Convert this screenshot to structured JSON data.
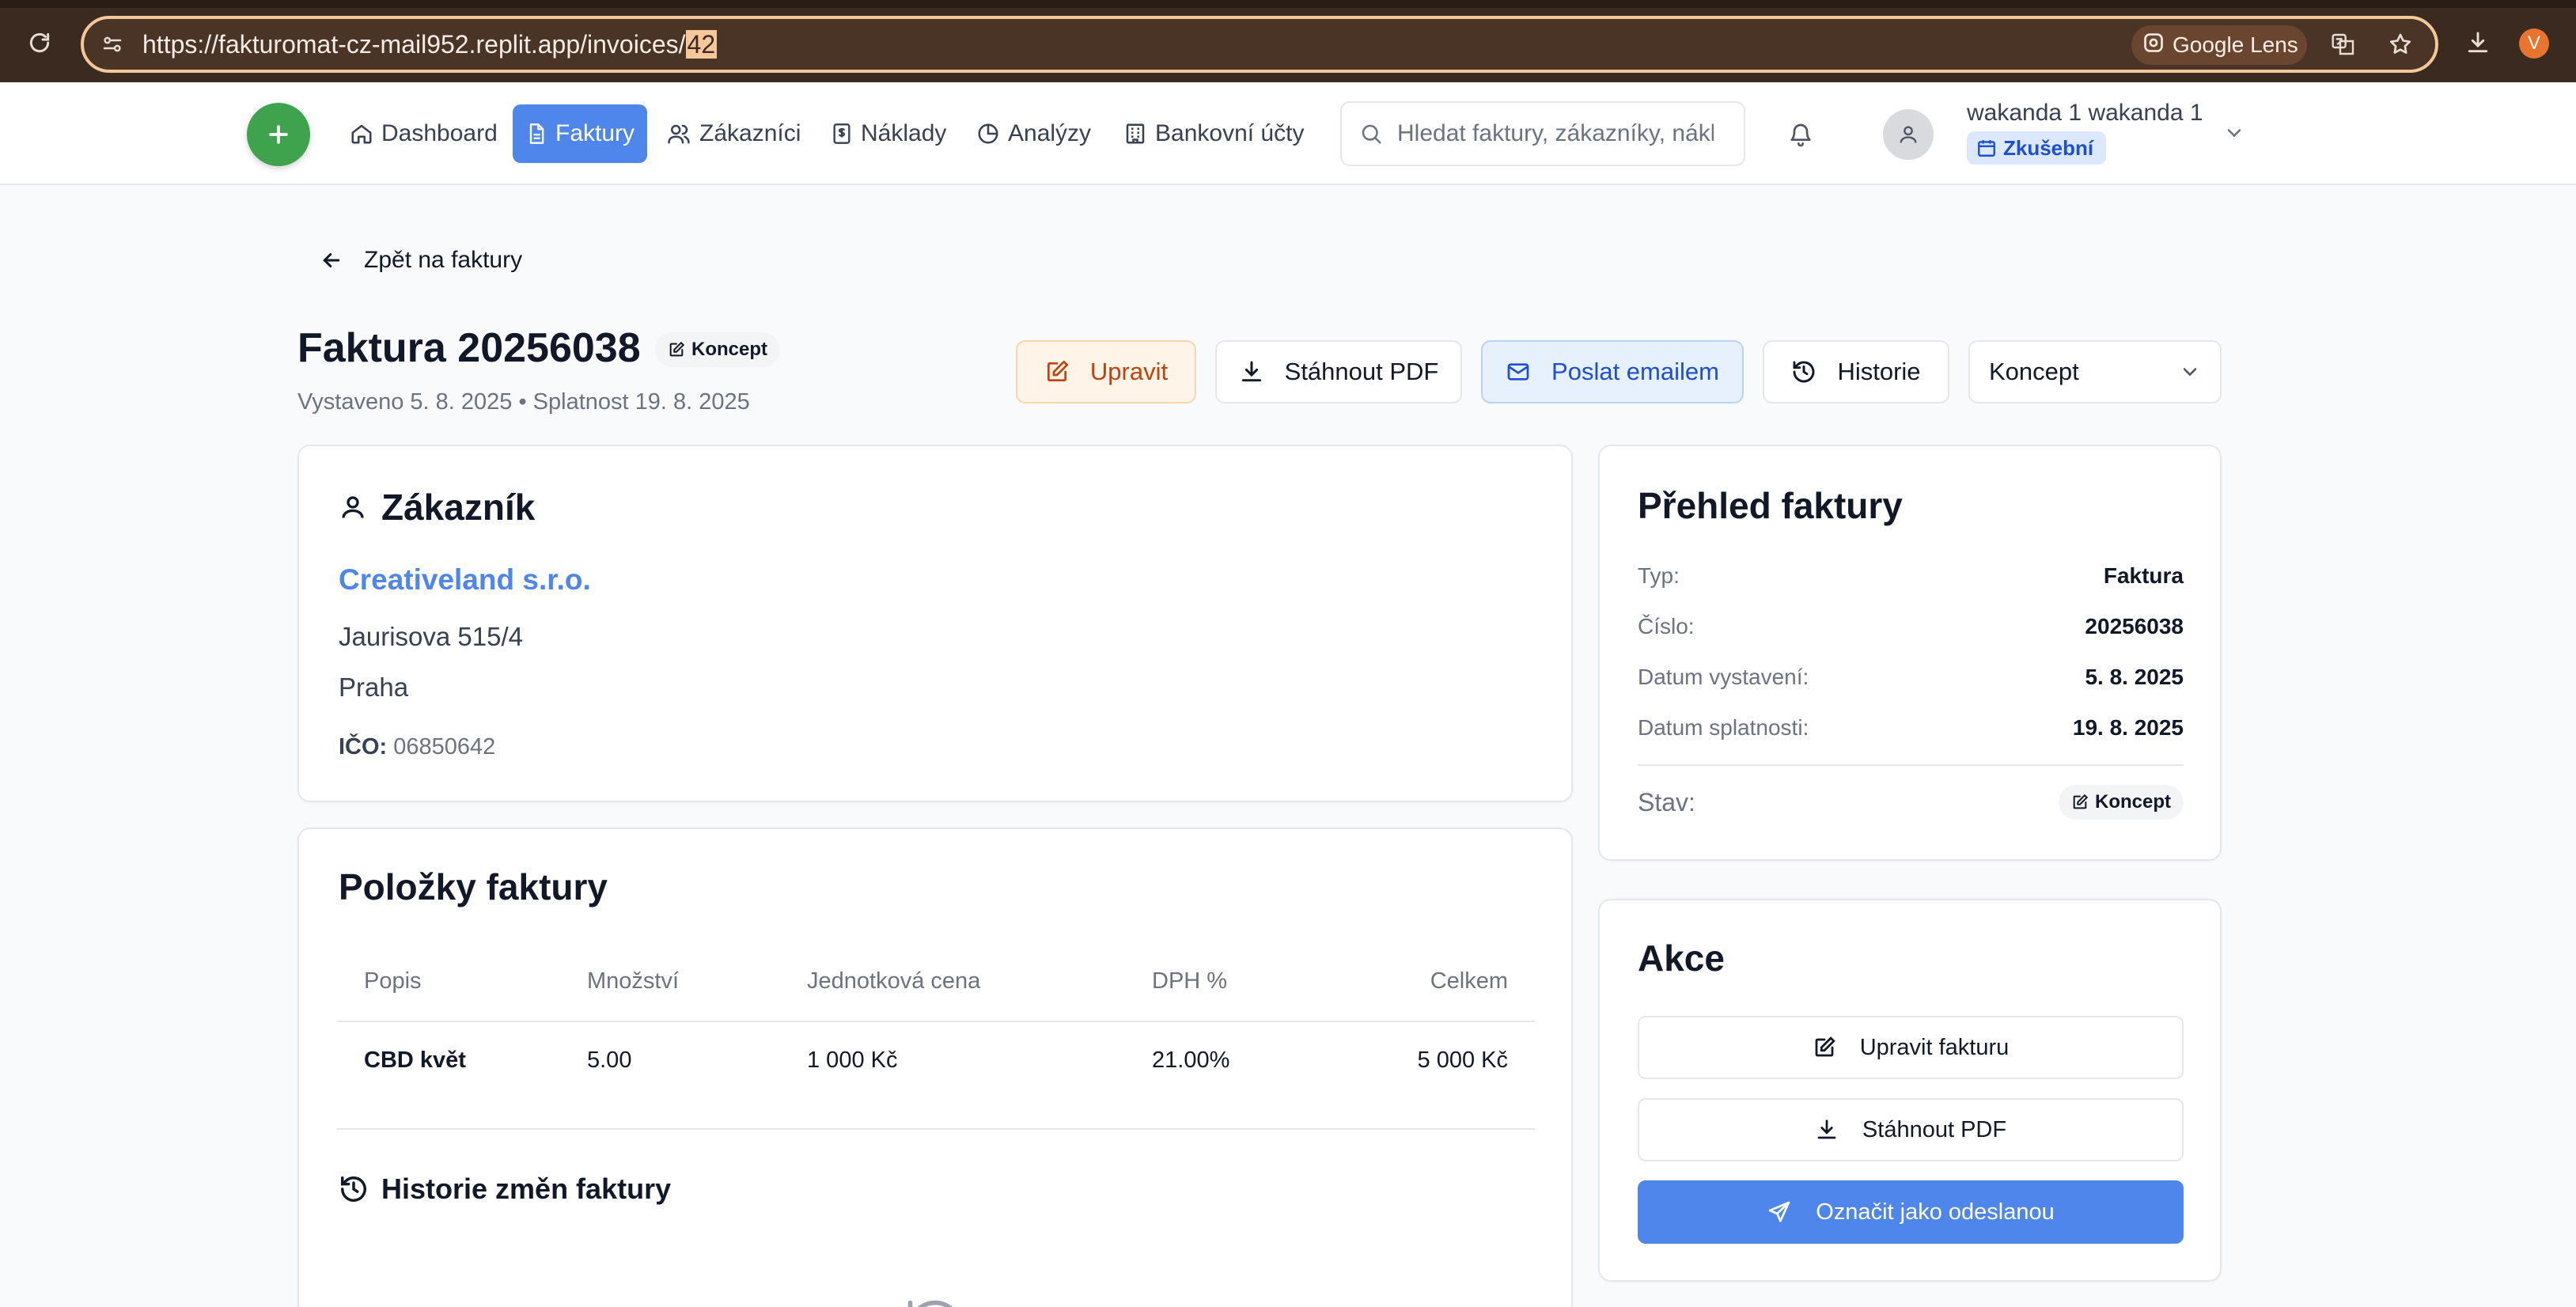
{
  "browser": {
    "url_prefix": "https://fakturomat-cz-mail952.replit.app/invoices/",
    "url_highlight": "42",
    "lens_label": "Google Lens",
    "profile_initial": "V"
  },
  "nav": {
    "items": [
      {
        "label": "Dashboard",
        "icon": "home-icon"
      },
      {
        "label": "Faktury",
        "icon": "document-icon",
        "active": true
      },
      {
        "label": "Zákazníci",
        "icon": "users-icon"
      },
      {
        "label": "Náklady",
        "icon": "receipt-icon"
      },
      {
        "label": "Analýzy",
        "icon": "pie-chart-icon"
      },
      {
        "label": "Bankovní účty",
        "icon": "bank-icon"
      }
    ],
    "search_placeholder": "Hledat faktury, zákazníky, náklady...",
    "user_name": "wakanda 1 wakanda 1",
    "plan_badge": "Zkušební",
    "accent_color": "#4f86ec",
    "fab_color": "#3fa34d"
  },
  "page": {
    "back_label": "Zpět na faktury",
    "title": "Faktura 20256038",
    "status_badge": "Koncept",
    "issued_text": "Vystaveno 5. 8. 2025 • Splatnost 19. 8. 2025",
    "toolbar": {
      "edit": "Upravit",
      "download_pdf": "Stáhnout PDF",
      "send_email": "Poslat emailem",
      "history": "Historie",
      "status_select": "Koncept"
    }
  },
  "customer": {
    "heading": "Zákazník",
    "name": "Creativeland s.r.o.",
    "street": "Jaurisova 515/4",
    "city": "Praha",
    "ico_label": "IČO:",
    "ico_value": "06850642"
  },
  "items": {
    "heading": "Položky faktury",
    "columns": [
      "Popis",
      "Množství",
      "Jednotková cena",
      "DPH %",
      "Celkem"
    ],
    "rows": [
      [
        "CBD květ",
        "5.00",
        "1 000 Kč",
        "21.00%",
        "5 000 Kč"
      ]
    ],
    "history_heading": "Historie změn faktury"
  },
  "overview": {
    "heading": "Přehled faktury",
    "rows": [
      {
        "label": "Typ:",
        "value": "Faktura"
      },
      {
        "label": "Číslo:",
        "value": "20256038"
      },
      {
        "label": "Datum vystavení:",
        "value": "5. 8. 2025"
      },
      {
        "label": "Datum splatnosti:",
        "value": "19. 8. 2025"
      }
    ],
    "status_label": "Stav:",
    "status_value": "Koncept"
  },
  "actions": {
    "heading": "Akce",
    "edit_invoice": "Upravit fakturu",
    "download_pdf": "Stáhnout PDF",
    "mark_sent": "Označit jako odeslanou"
  }
}
